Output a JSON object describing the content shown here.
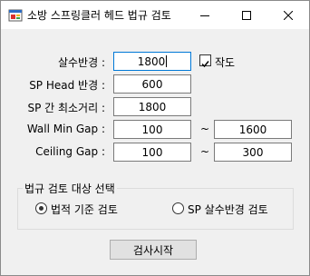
{
  "window": {
    "title": "소방 스프링클러 헤드 법규 검토",
    "icon": "app-form-icon",
    "controls": [
      "minimize-icon",
      "maximize-icon",
      "close-icon"
    ]
  },
  "fields": {
    "spray_radius": {
      "label": "살수반경 :",
      "value": "1800"
    },
    "head_radius": {
      "label": "SP Head 반경 :",
      "value": "600"
    },
    "min_spacing": {
      "label": "SP 간 최소거리 :",
      "value": "1800"
    },
    "wall_gap": {
      "label": "Wall Min Gap :",
      "min": "100",
      "max": "1600"
    },
    "ceiling_gap": {
      "label": "Ceiling Gap :",
      "min": "100",
      "max": "300"
    },
    "range_separator": "~"
  },
  "draw": {
    "label": "작도",
    "checked": true
  },
  "mode_group": {
    "title": "법규 검토 대상 선택",
    "options": [
      {
        "label": "법적 기준 검토",
        "selected": true
      },
      {
        "label": "SP 살수반경 검토",
        "selected": false
      }
    ]
  },
  "start_button": {
    "label": "검사시작"
  },
  "colors": {
    "focus_border": "#0078d7",
    "window_bg": "#f0f0f0"
  }
}
